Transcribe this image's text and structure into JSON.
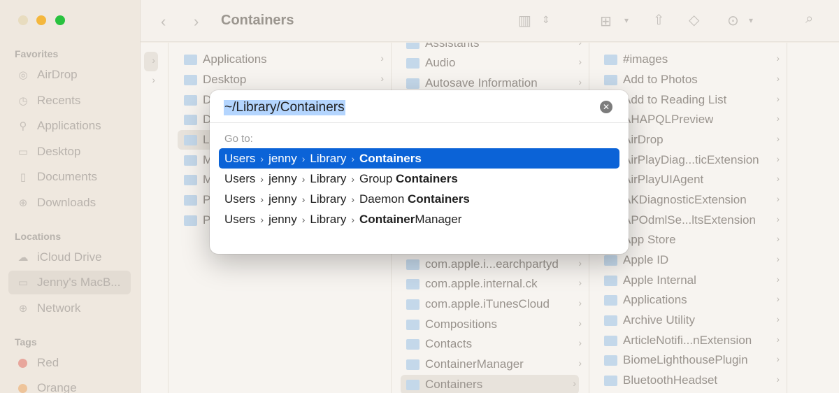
{
  "window": {
    "title": "Containers"
  },
  "sidebar": {
    "favorites_heading": "Favorites",
    "favorites": [
      {
        "label": "AirDrop",
        "icon": "airdrop-icon"
      },
      {
        "label": "Recents",
        "icon": "clock-icon"
      },
      {
        "label": "Applications",
        "icon": "applications-icon"
      },
      {
        "label": "Desktop",
        "icon": "desktop-icon"
      },
      {
        "label": "Documents",
        "icon": "document-icon"
      },
      {
        "label": "Downloads",
        "icon": "download-icon"
      }
    ],
    "locations_heading": "Locations",
    "locations": [
      {
        "label": "iCloud Drive",
        "icon": "cloud-icon"
      },
      {
        "label": "Jenny's MacB...",
        "icon": "laptop-icon"
      },
      {
        "label": "Network",
        "icon": "globe-icon"
      }
    ],
    "tags_heading": "Tags",
    "tags": [
      {
        "label": "Red",
        "color": "#e8a69c"
      },
      {
        "label": "Orange",
        "color": "#eec49a"
      }
    ]
  },
  "columns": {
    "col2": [
      "Applications",
      "Desktop",
      "D",
      "D",
      "L",
      "M",
      "M",
      "P",
      "P"
    ],
    "col3_top": [
      "Assistants",
      "Audio",
      "Autosave Information"
    ],
    "col3_bottom": [
      "com.apple.i...earchpartyd",
      "com.apple.internal.ck",
      "com.apple.iTunesCloud",
      "Compositions",
      "Contacts",
      "ContainerManager",
      "Containers"
    ],
    "col4": [
      "#images",
      "Add to Photos",
      "Add to Reading List",
      "AHAPQLPreview",
      "AirDrop",
      "AirPlayDiag...ticExtension",
      "AirPlayUIAgent",
      "AKDiagnosticExtension",
      "APOdmlSe...ltsExtension",
      "App Store",
      "Apple ID",
      "Apple Internal",
      "Applications",
      "Archive Utility",
      "ArticleNotifi...nExtension",
      "BiomeLighthousePlugin",
      "BluetoothHeadset"
    ]
  },
  "dialog": {
    "path_value": "~/Library/Containers",
    "goto_label": "Go to:",
    "suggestions": [
      {
        "p1": "Users",
        "p2": "jenny",
        "p3": "Library",
        "pre": "",
        "bold": "Containers",
        "post": ""
      },
      {
        "p1": "Users",
        "p2": "jenny",
        "p3": "Library",
        "pre": "Group ",
        "bold": "Containers",
        "post": ""
      },
      {
        "p1": "Users",
        "p2": "jenny",
        "p3": "Library",
        "pre": "Daemon ",
        "bold": "Containers",
        "post": ""
      },
      {
        "p1": "Users",
        "p2": "jenny",
        "p3": "Library",
        "pre": "",
        "bold": "Container",
        "post": "Manager"
      }
    ],
    "separator": "›"
  }
}
